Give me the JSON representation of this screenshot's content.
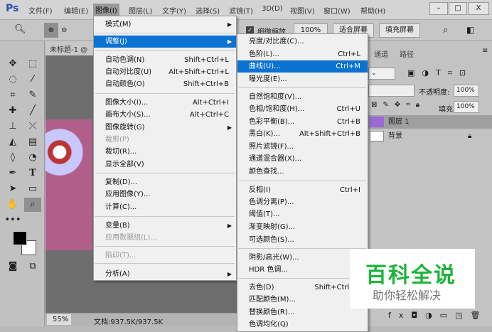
{
  "app": {
    "logo": "Ps"
  },
  "menubar": [
    "文件(F)",
    "编辑(E)",
    "图像(I)",
    "图层(L)",
    "文字(Y)",
    "选择(S)",
    "滤镜(T)",
    "3D(D)",
    "视图(V)",
    "窗口(W)",
    "帮助(H)"
  ],
  "window_controls": {
    "minimize": "–",
    "maximize": "□",
    "close": "X"
  },
  "options": {
    "scrubby_zoom": "细微缩放",
    "zoom_value": "100%",
    "fit_screen": "适合屏幕",
    "fill_screen": "填充屏幕"
  },
  "document": {
    "tab": "未标题-1 @",
    "zoom": "55%",
    "doc_size": "文档:937.5K/937.5K"
  },
  "image_menu": [
    {
      "label": "模式(M)",
      "submenu": true
    },
    {
      "label": "调整(J)",
      "submenu": true,
      "highlighted": true
    },
    {
      "label": "自动色调(N)",
      "shortcut": "Shift+Ctrl+L"
    },
    {
      "label": "自动对比度(U)",
      "shortcut": "Alt+Shift+Ctrl+L"
    },
    {
      "label": "自动颜色(O)",
      "shortcut": "Shift+Ctrl+B"
    },
    {
      "label": "图像大小(I)...",
      "shortcut": "Alt+Ctrl+I"
    },
    {
      "label": "画布大小(S)...",
      "shortcut": "Alt+Ctrl+C"
    },
    {
      "label": "图像旋转(G)",
      "submenu": true
    },
    {
      "label": "裁剪(P)",
      "disabled": true
    },
    {
      "label": "裁切(R)..."
    },
    {
      "label": "显示全部(V)"
    },
    {
      "label": "复制(D)..."
    },
    {
      "label": "应用图像(Y)..."
    },
    {
      "label": "计算(C)..."
    },
    {
      "label": "变量(B)",
      "submenu": true
    },
    {
      "label": "应用数据组(L)...",
      "disabled": true
    },
    {
      "label": "陷印(T)...",
      "disabled": true
    },
    {
      "label": "分析(A)",
      "submenu": true
    }
  ],
  "adjust_menu": [
    {
      "label": "亮度/对比度(C)..."
    },
    {
      "label": "色阶(L)...",
      "shortcut": "Ctrl+L"
    },
    {
      "label": "曲线(U)...",
      "shortcut": "Ctrl+M",
      "highlighted": true
    },
    {
      "label": "曝光度(E)..."
    },
    {
      "label": "自然饱和度(V)..."
    },
    {
      "label": "色相/饱和度(H)...",
      "shortcut": "Ctrl+U"
    },
    {
      "label": "色彩平衡(B)...",
      "shortcut": "Ctrl+B"
    },
    {
      "label": "黑白(K)...",
      "shortcut": "Alt+Shift+Ctrl+B"
    },
    {
      "label": "照片滤镜(F)..."
    },
    {
      "label": "通道混合器(X)..."
    },
    {
      "label": "颜色查找..."
    },
    {
      "label": "反相(I)",
      "shortcut": "Ctrl+I"
    },
    {
      "label": "色调分离(P)..."
    },
    {
      "label": "阈值(T)..."
    },
    {
      "label": "渐变映射(G)..."
    },
    {
      "label": "可选颜色(S)..."
    },
    {
      "label": "阴影/高光(W)..."
    },
    {
      "label": "HDR 色调..."
    },
    {
      "label": "去色(D)",
      "shortcut": "Shift+Ctrl+U"
    },
    {
      "label": "匹配颜色(M)..."
    },
    {
      "label": "替换颜色(R)..."
    },
    {
      "label": "色调均化(Q)"
    }
  ],
  "panel": {
    "tabs": [
      "通道",
      "路径"
    ],
    "opacity_label": "不透明度:",
    "opacity": "100%",
    "fill_label": "填充:",
    "fill": "100%",
    "layers": [
      "图层 1",
      "背景"
    ]
  },
  "watermark": {
    "title": "百科全说",
    "subtitle": "助你轻松解决"
  },
  "colors": {
    "highlight": "#0a72d1",
    "watermark_green": "#1db43a"
  }
}
